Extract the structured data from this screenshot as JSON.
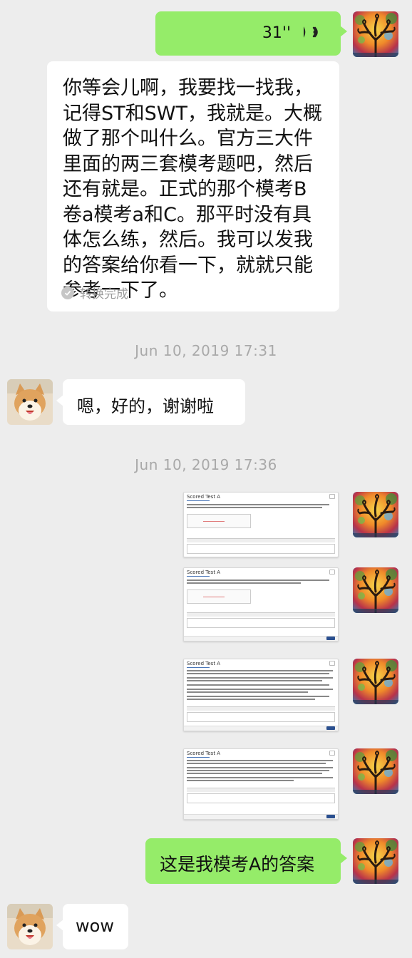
{
  "messages": {
    "voice": {
      "duration": "31''"
    },
    "transcript": {
      "text": "你等会儿啊，我要找一找我，记得ST和SWT，我就是。大概做了那个叫什么。官方三大件里面的两三套模考题吧，然后还有就是。正式的那个模考B卷a模考a和C。那平时没有具体怎么练，然后。我可以发我的答案给你看一下，就就只能参考一下了。",
      "status": "转换完成"
    },
    "timestamp_1": "Jun 10, 2019 17:31",
    "reply_1": "嗯，好的，谢谢啦",
    "timestamp_2": "Jun 10, 2019 17:36",
    "screenshots": [
      {
        "title": "Scored Test A"
      },
      {
        "title": "Scored Test A"
      },
      {
        "title": "Scored Test A"
      },
      {
        "title": "Scored Test A"
      }
    ],
    "caption": "这是我模考A的答案",
    "reply_2": "wow"
  },
  "icons": {
    "self_avatar": "tree-avatar-icon",
    "friend_avatar": "shiba-dog-avatar-icon",
    "voice": "voice-wave-icon",
    "check": "check-circle-icon"
  },
  "colors": {
    "background": "#ededed",
    "self_bubble": "#95ec69",
    "other_bubble": "#ffffff",
    "timestamp": "#a9a9a9"
  }
}
